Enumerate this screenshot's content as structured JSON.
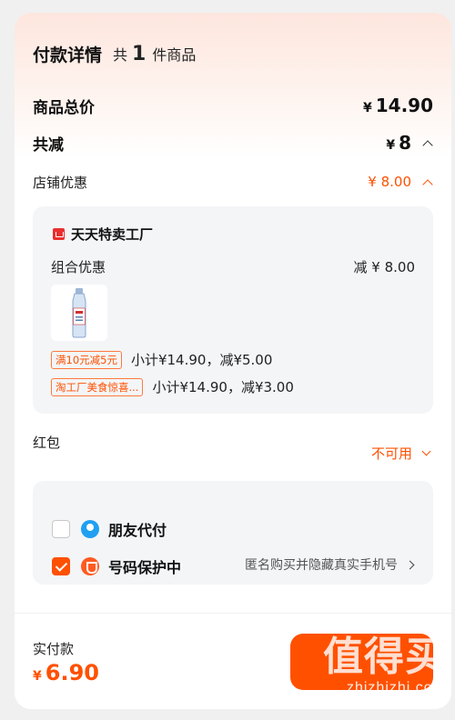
{
  "header": {
    "title": "付款详情",
    "count_prefix": "共",
    "count": "1",
    "count_suffix": "件商品"
  },
  "total": {
    "label": "商品总价",
    "currency": "¥",
    "amount": "14.90"
  },
  "discount": {
    "label": "共减",
    "currency": "¥",
    "amount": "8"
  },
  "shop_discount": {
    "label": "店铺优惠",
    "value": "¥ 8.00"
  },
  "shop": {
    "name": "天天特卖工厂",
    "combo_label": "组合优惠",
    "combo_value": "减 ¥ 8.00",
    "promos": [
      {
        "tag": "满10元减5元",
        "text": "小计¥14.90，减¥5.00"
      },
      {
        "tag": "淘工厂美食惊喜...",
        "text": "小计¥14.90，减¥3.00"
      }
    ]
  },
  "hongbao": {
    "label": "红包",
    "value": "不可用"
  },
  "options": {
    "friend_pay": {
      "label": "朋友代付",
      "checked": false
    },
    "number_protect": {
      "label": "号码保护中",
      "checked": true,
      "desc": "匿名购买并隐藏真实手机号"
    }
  },
  "footer": {
    "label": "实付款",
    "currency": "¥",
    "amount": "6.90"
  },
  "watermark": {
    "title": "值得买",
    "url": "zhizhizhi.com"
  },
  "colors": {
    "accent": "#ff5000",
    "header_gradient_top": "#fde6de",
    "panel_bg": "#f4f5f7",
    "friend_icon": "#1fa0f2"
  },
  "icons": [
    "chevron-up-icon",
    "chevron-down-icon",
    "chevron-right-icon",
    "shop-logo-icon",
    "friend-pay-icon",
    "number-protect-icon",
    "checkbox-icon"
  ]
}
